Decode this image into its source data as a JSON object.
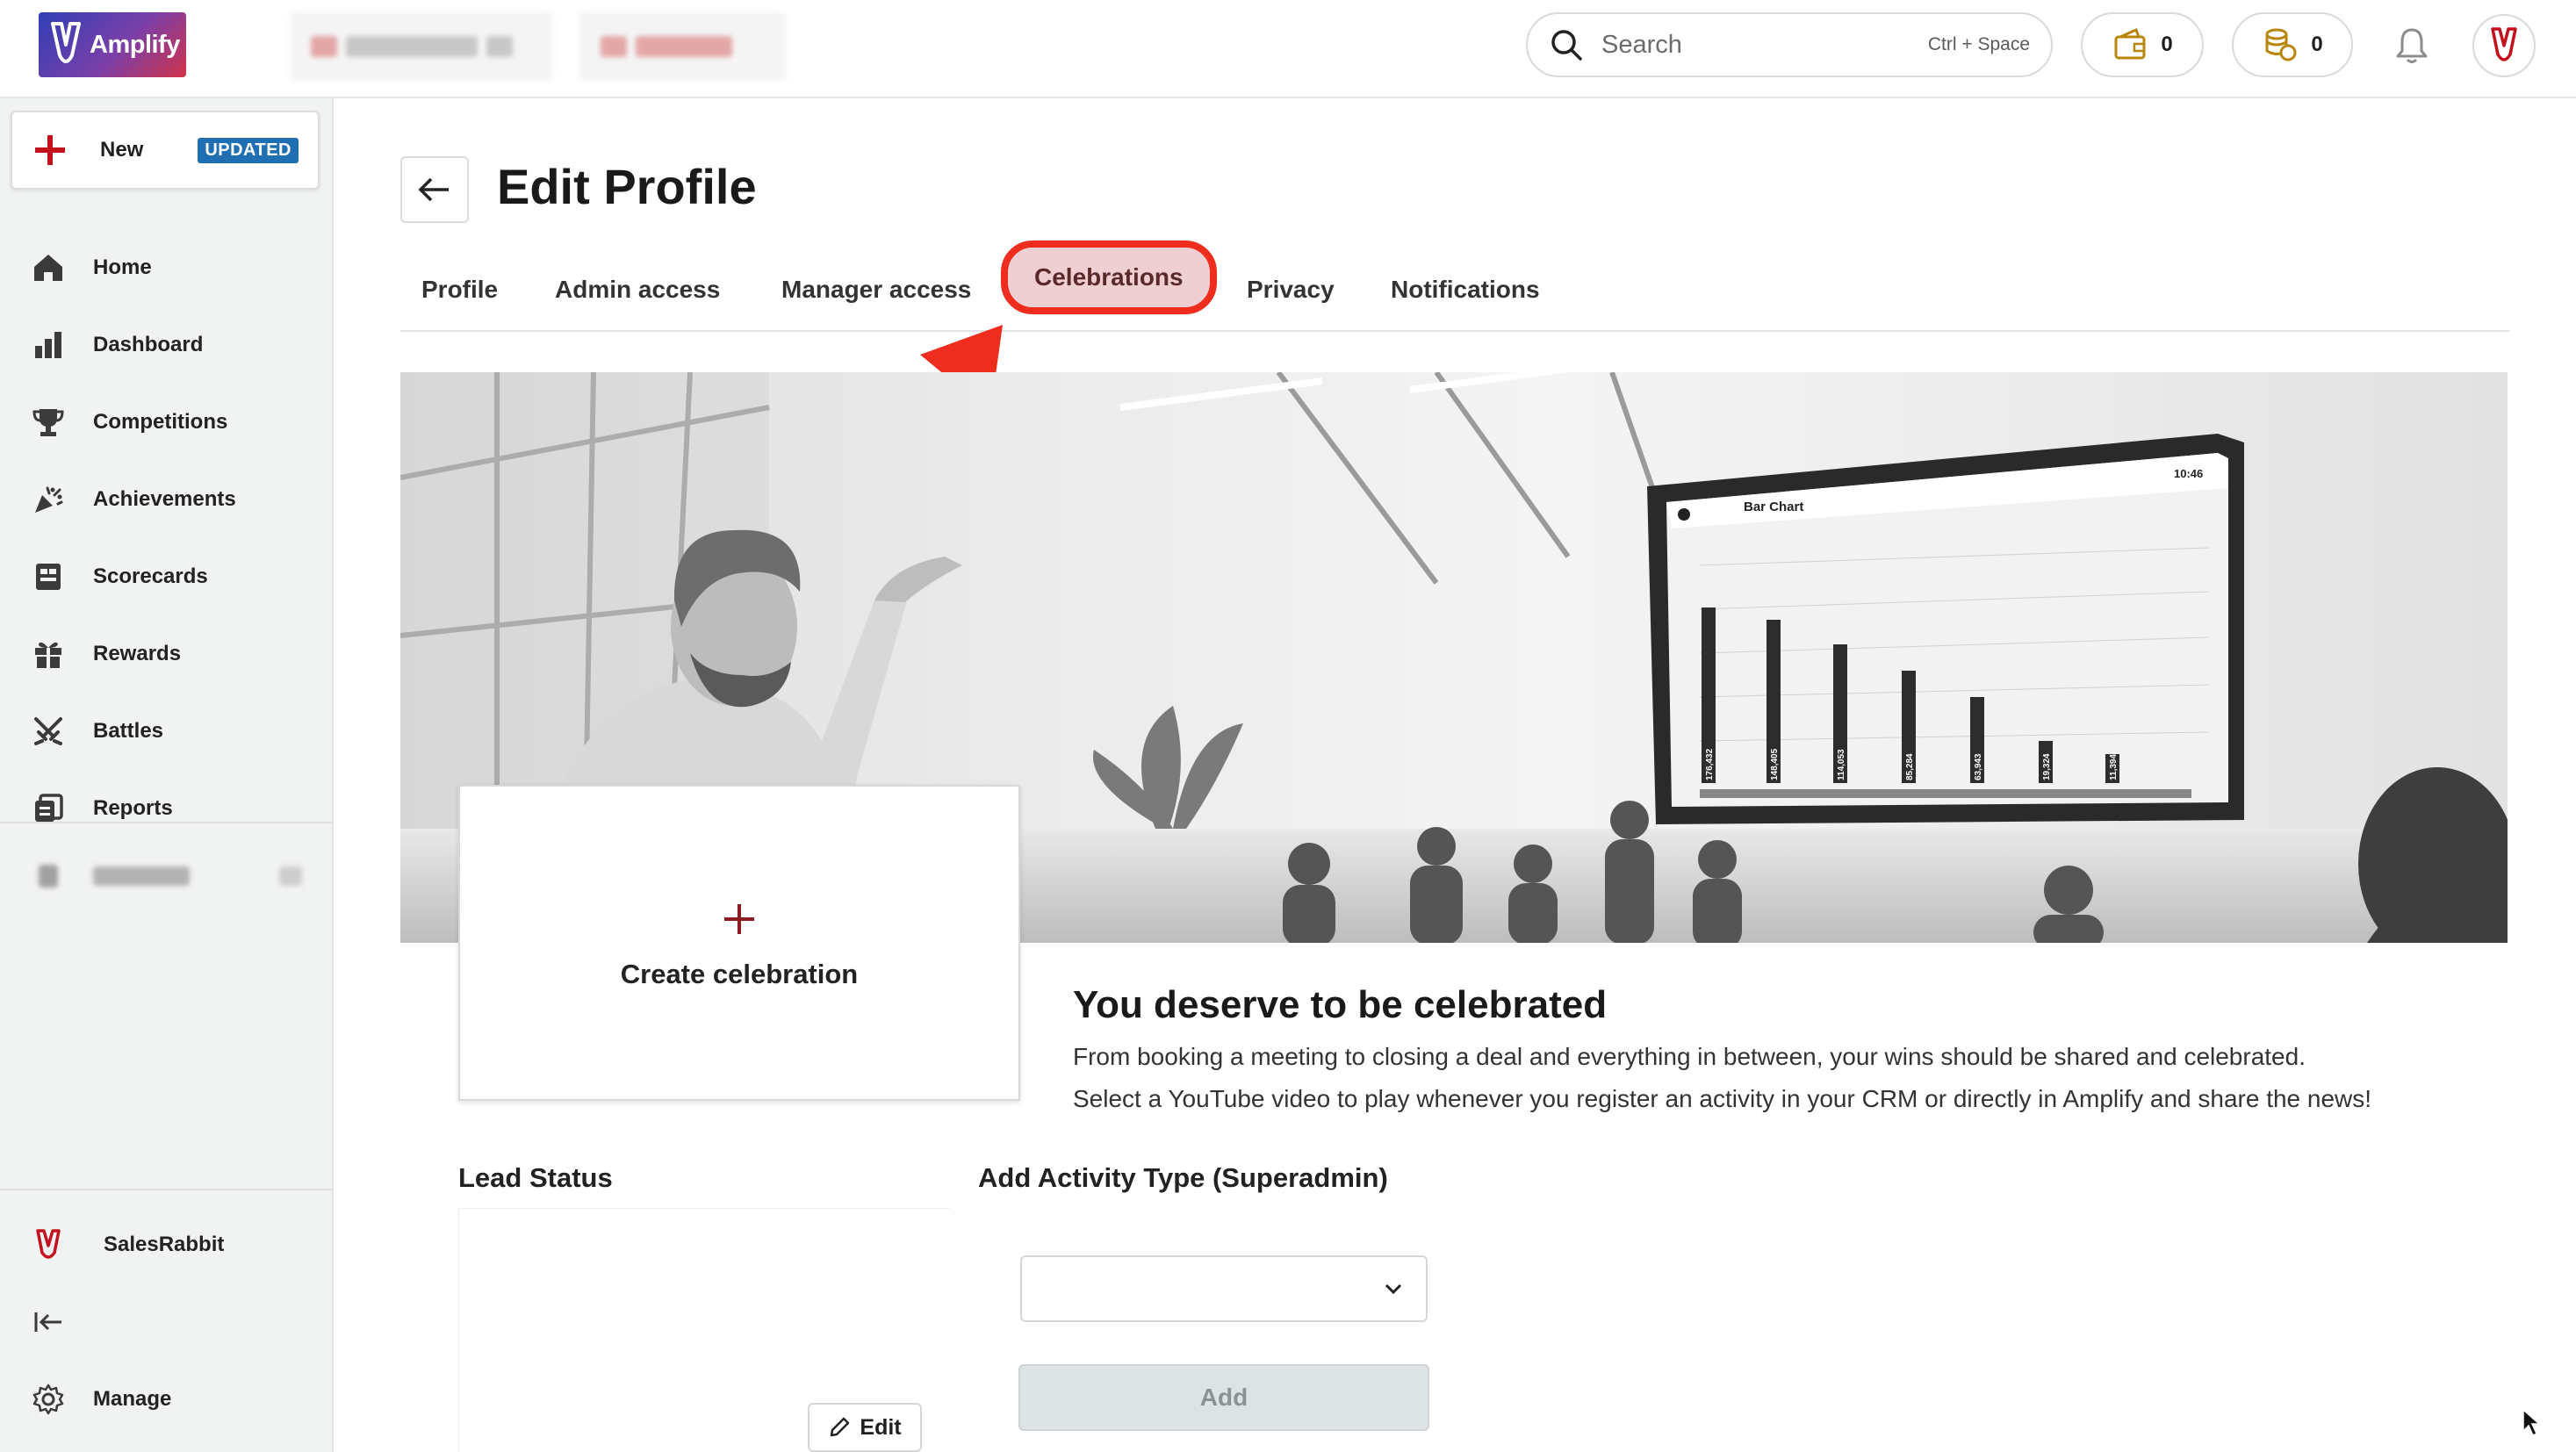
{
  "app": {
    "logo_text": "Amplify"
  },
  "topbar": {
    "search_placeholder": "Search",
    "search_shortcut": "Ctrl + Space",
    "wallet_count": "0",
    "coins_count": "0"
  },
  "sidebar": {
    "new_label": "New",
    "new_badge": "UPDATED",
    "items": [
      {
        "label": "Home",
        "icon": "home-icon"
      },
      {
        "label": "Dashboard",
        "icon": "bar-chart-icon"
      },
      {
        "label": "Competitions",
        "icon": "trophy-icon"
      },
      {
        "label": "Achievements",
        "icon": "party-popper-icon"
      },
      {
        "label": "Scorecards",
        "icon": "scorecard-icon"
      },
      {
        "label": "Rewards",
        "icon": "gift-icon"
      },
      {
        "label": "Battles",
        "icon": "swords-icon"
      },
      {
        "label": "Reports",
        "icon": "reports-icon"
      }
    ],
    "org_name": "SalesRabbit",
    "manage_label": "Manage"
  },
  "page": {
    "title": "Edit Profile",
    "tabs": [
      "Profile",
      "Admin access",
      "Manager access",
      "Celebrations",
      "Privacy",
      "Notifications"
    ],
    "active_tab": "Celebrations"
  },
  "hero": {
    "screen_title": "Bar Chart",
    "screen_time": "10:46",
    "bar_values": [
      "176,432",
      "148,405",
      "114,053",
      "85,284",
      "63,943",
      "19,324",
      "11,394"
    ]
  },
  "celebrations": {
    "create_label": "Create celebration",
    "headline": "You deserve to be celebrated",
    "text_line1": "From booking a meeting to closing a deal and everything in between, your wins should be shared and celebrated.",
    "text_line2": "Select a YouTube video to play whenever you register an activity in your CRM or directly in Amplify and share the news!",
    "lead_status_label": "Lead Status",
    "edit_label": "Edit",
    "add_activity_label": "Add Activity Type (Superadmin)",
    "select_value": "",
    "add_label": "Add"
  },
  "colors": {
    "highlight": "#ef2d1e",
    "badge": "#1f6fb2",
    "brand_red": "#c3121e"
  }
}
